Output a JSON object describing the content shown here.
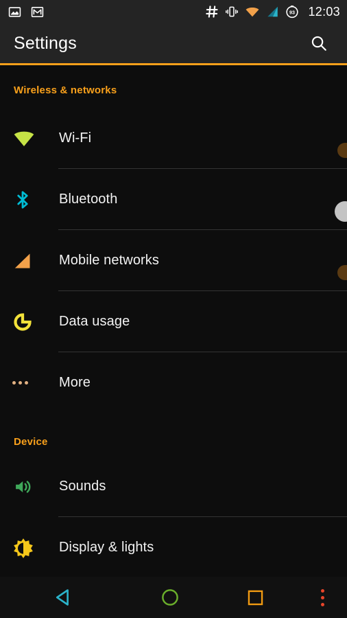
{
  "statusbar": {
    "left_icons": [
      {
        "name": "screenshot-image-icon"
      },
      {
        "name": "gmail-icon"
      }
    ],
    "right_icons": [
      {
        "name": "hash-icon"
      },
      {
        "name": "vibrate-icon"
      },
      {
        "name": "wifi-icon"
      },
      {
        "name": "cellular-signal-icon"
      },
      {
        "name": "battery-icon",
        "value": "93"
      }
    ],
    "time": "12:03"
  },
  "toolbar": {
    "title": "Settings",
    "search_icon": "search-icon",
    "accent_color": "#f9a01b"
  },
  "sections": [
    {
      "header": "Wireless & networks",
      "rows": [
        {
          "label": "Wi-Fi",
          "icon": "wifi-icon",
          "icon_color": "#c6e346",
          "toggle": "on",
          "divider": true
        },
        {
          "label": "Bluetooth",
          "icon": "bluetooth-icon",
          "icon_color": "#00bcd4",
          "toggle": "off",
          "divider": true
        },
        {
          "label": "Mobile networks",
          "icon": "signal-bars-icon",
          "icon_color": "#f2a14a",
          "toggle": "on",
          "divider": true
        },
        {
          "label": "Data usage",
          "icon": "data-usage-pie-icon",
          "icon_color": "#f2e13a",
          "toggle": "none",
          "divider": true
        },
        {
          "label": "More",
          "icon": "more-dots-icon",
          "icon_color": "#e2b183",
          "toggle": "none",
          "divider": false
        }
      ]
    },
    {
      "header": "Device",
      "rows": [
        {
          "label": "Sounds",
          "icon": "volume-speaker-icon",
          "icon_color": "#3fa85a",
          "toggle": "none",
          "divider": true
        },
        {
          "label": "Display & lights",
          "icon": "brightness-icon",
          "icon_color": "#f5c71a",
          "toggle": "none",
          "divider": false
        }
      ]
    }
  ],
  "navbar": {
    "back": {
      "icon": "back-triangle-icon",
      "color": "#2bb3c9"
    },
    "home": {
      "icon": "home-circle-icon",
      "color": "#6aae2b"
    },
    "recent": {
      "icon": "recents-square-icon",
      "color": "#f39c12"
    },
    "menu": {
      "icon": "overflow-menu-icon",
      "color": "#e8452a"
    }
  }
}
